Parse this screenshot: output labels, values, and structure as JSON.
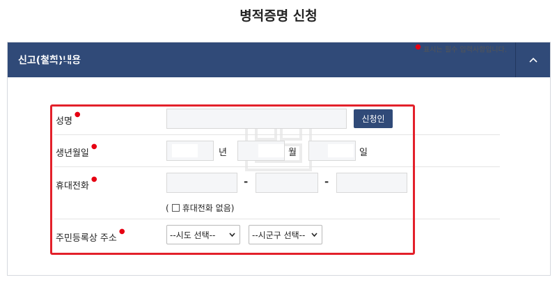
{
  "page_title": "병적증명 신청",
  "panel": {
    "title": "신고(철회)내용",
    "toggle_icon": "chevron-up-icon"
  },
  "required_note": "표시는 필수 입력사항입니다.",
  "form": {
    "name": {
      "label": "성명",
      "value": "",
      "button_label": "신청인"
    },
    "birth": {
      "label": "생년월일",
      "year_unit": "년",
      "month_unit": "월",
      "day_unit": "일",
      "year": "",
      "month": "",
      "day": ""
    },
    "phone": {
      "label": "휴대전화",
      "sep": "-",
      "no_phone_open": "(",
      "no_phone_label": "휴대전화 없음)",
      "no_phone_checked": false
    },
    "address": {
      "label": "주민등록상 주소",
      "sido_selected": "--시도 선택--",
      "sigungu_selected": "--시군구 선택--"
    }
  },
  "colors": {
    "header_bg": "#304a78",
    "required_dot": "#e60012",
    "highlight": "#e3202a"
  }
}
